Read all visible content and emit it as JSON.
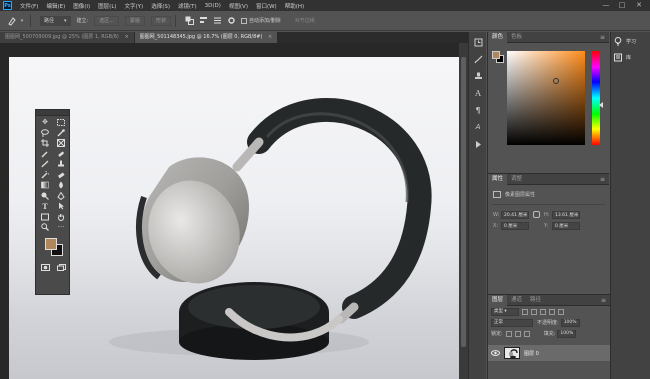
{
  "app": {
    "logo_text": "Ps"
  },
  "menu": [
    "文件(F)",
    "编辑(E)",
    "图像(I)",
    "图层(L)",
    "文字(Y)",
    "选择(S)",
    "滤镜(T)",
    "3D(D)",
    "视图(V)",
    "窗口(W)",
    "帮助(H)"
  ],
  "window_controls": {
    "minimize": "—",
    "maximize": "□",
    "close": "✕"
  },
  "options": {
    "tool_dropdown": "▾",
    "mode": "路径",
    "make_label": "建立:",
    "selection_btn": "选区...",
    "mask_btn": "蒙版",
    "shape_btn": "形状",
    "auto_add_delete": "自动添加/删除",
    "align_edges": "对齐边缘"
  },
  "tabs": [
    {
      "label": "图图网_500709009.jpg @ 25% (图层 1, RGB/8)",
      "close": "×",
      "active": false
    },
    {
      "label": "图图网_501148345.jpg @ 16.7% (图层 0, RGB/8#)",
      "close": "×",
      "active": true
    }
  ],
  "color_panel": {
    "tabs": [
      "颜色",
      "色板"
    ],
    "menu": "≡"
  },
  "properties_panel": {
    "tabs": [
      "属性",
      "调整"
    ],
    "menu": "≡",
    "title": "像素图层属性",
    "w_label": "W:",
    "w_value": "20.41 厘米",
    "h_label": "H:",
    "h_value": "13.61 厘米",
    "x_label": "X:",
    "x_value": "0 厘米",
    "y_label": "Y:",
    "y_value": "0 厘米",
    "link": "⊖"
  },
  "layers_panel": {
    "tabs": [
      "图层",
      "通道",
      "路径"
    ],
    "menu": "≡",
    "kind_select": "类型",
    "blend_mode": "正常",
    "opacity_label": "不透明度:",
    "opacity_value": "100%",
    "lock_label": "锁定:",
    "fill_label": "填充:",
    "fill_value": "100%",
    "layer_name": "图层 0"
  },
  "right_column": [
    {
      "label": "学习",
      "icon": "lightbulb-icon"
    },
    {
      "label": "库",
      "icon": "library-icon"
    }
  ],
  "colors": {
    "foreground": "#b0875c",
    "background": "#000000",
    "accent": "#31a8ff"
  }
}
